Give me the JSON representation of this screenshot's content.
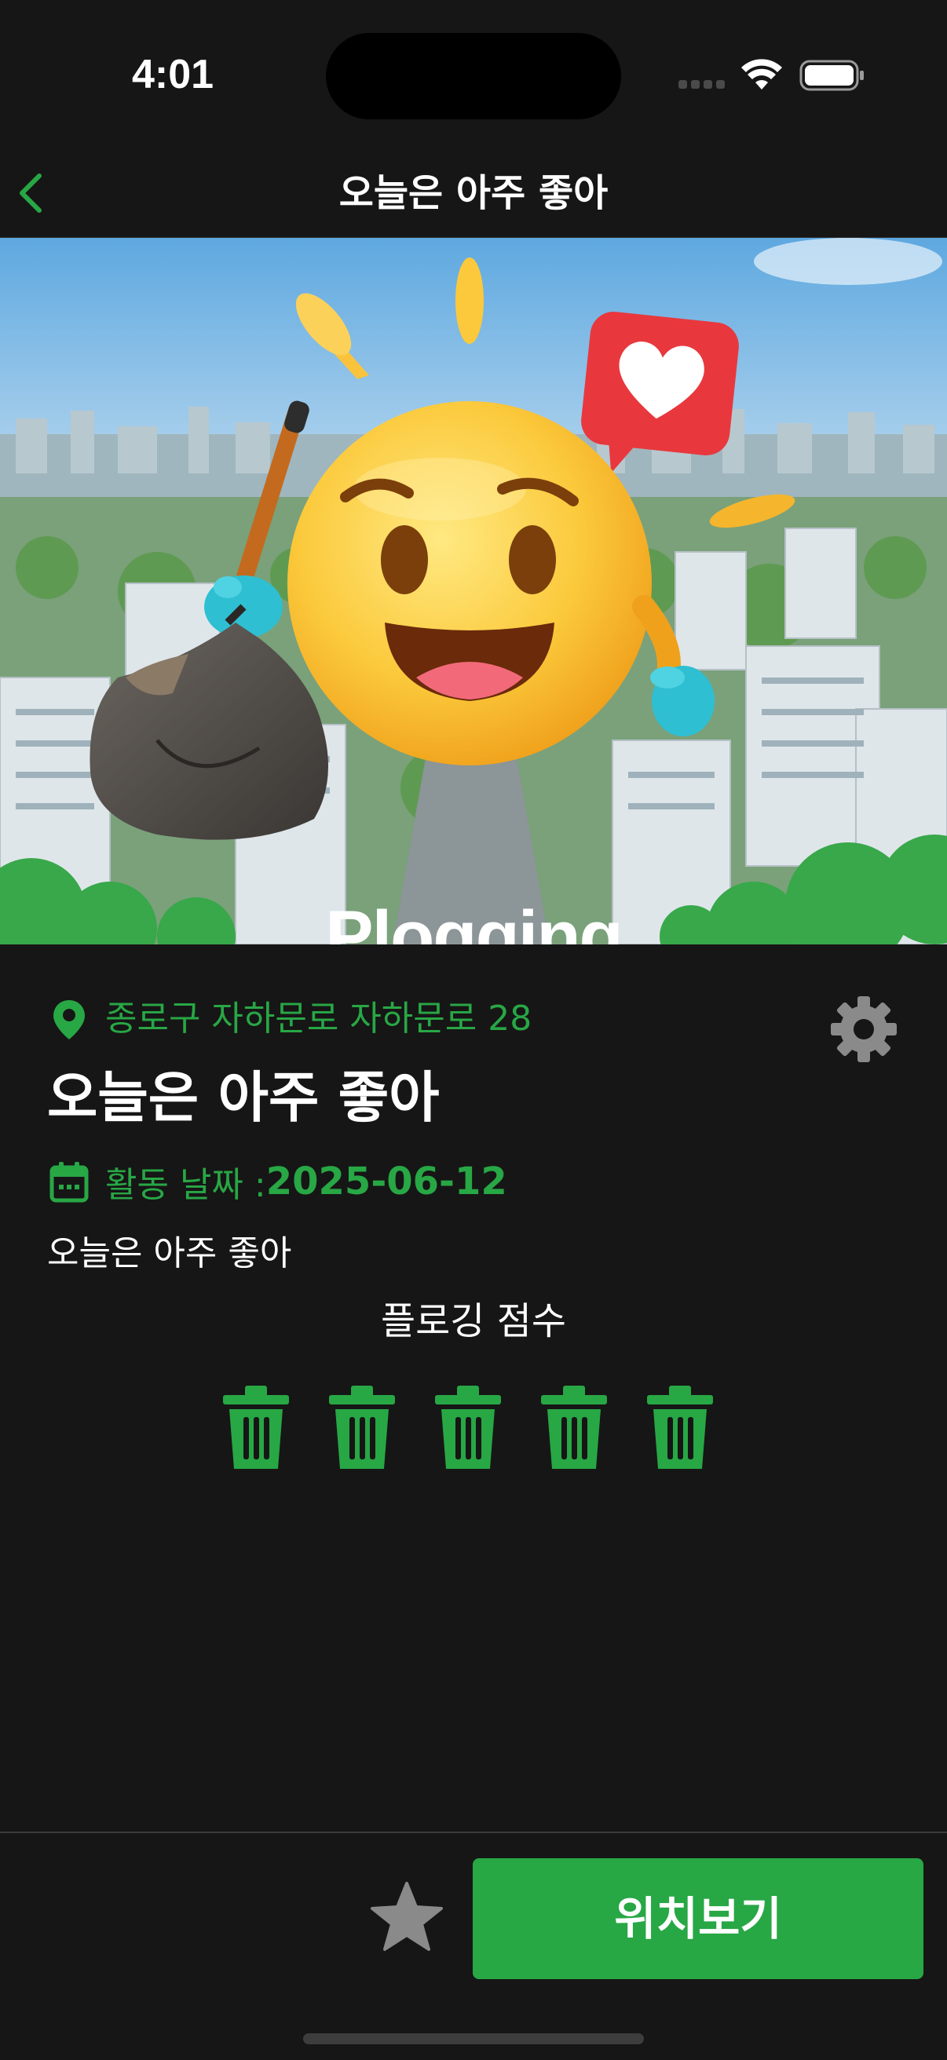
{
  "status_bar": {
    "time": "4:01"
  },
  "nav": {
    "title": "오늘은 아주 좋아",
    "back_icon": "chevron-left-icon"
  },
  "hero": {
    "caption": "Plogging"
  },
  "post": {
    "location": "종로구 자하문로 자하문로 28",
    "title": "오늘은 아주 좋아",
    "date_label": "활동 날짜 :",
    "date_value": "2025-06-12",
    "description": "오늘은 아주 좋아",
    "score_label": "플로깅 점수",
    "score": 5,
    "score_max": 5
  },
  "bottom": {
    "map_button": "위치보기"
  },
  "colors": {
    "accent": "#28a745",
    "background": "#161616",
    "icon_gray": "#8a8a8a"
  }
}
